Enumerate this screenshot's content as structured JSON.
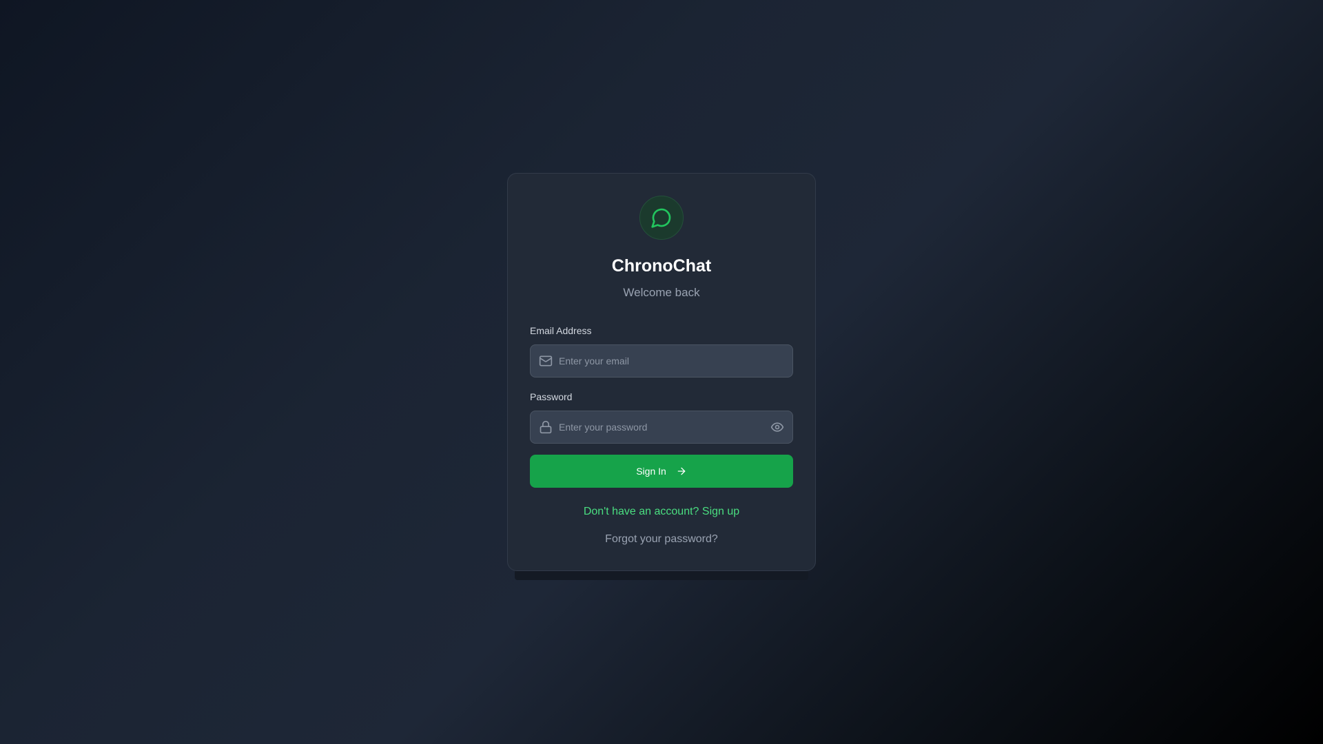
{
  "app": {
    "name": "ChronoChat",
    "subtitle": "Welcome back",
    "logo_icon": "message-circle-icon",
    "accent_color": "#16a34a",
    "link_color": "#4ade80"
  },
  "form": {
    "email": {
      "label": "Email Address",
      "placeholder": "Enter your email",
      "value": "",
      "icon": "mail-icon"
    },
    "password": {
      "label": "Password",
      "placeholder": "Enter your password",
      "value": "",
      "icon": "lock-icon",
      "toggle_icon": "eye-icon"
    },
    "submit": {
      "label": "Sign In",
      "icon": "arrow-right-icon"
    }
  },
  "links": {
    "signup": "Don't have an account? Sign up",
    "forgot": "Forgot your password?"
  }
}
